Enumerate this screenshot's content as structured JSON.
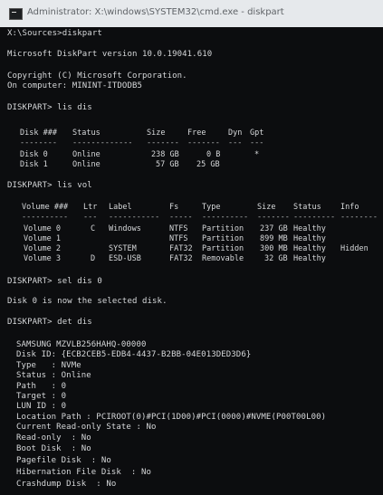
{
  "window": {
    "title": "Administrator: X:\\windows\\SYSTEM32\\cmd.exe - diskpart"
  },
  "console": {
    "prompt_line": "X:\\Sources>diskpart",
    "version_line": "Microsoft DiskPart version 10.0.19041.610",
    "copyright_line": "Copyright (C) Microsoft Corporation.",
    "computer_line": "On computer: MININT-ITDODB5",
    "cmd_lis_dis": "DISKPART> lis dis",
    "cmd_lis_vol": "DISKPART> lis vol",
    "cmd_sel_dis": "DISKPART> sel dis 0",
    "selected_msg": "Disk 0 is now the selected disk.",
    "cmd_det_dis": "DISKPART> det dis"
  },
  "disk_table": {
    "headers": [
      "Disk ###",
      "Status",
      "Size",
      "Free",
      "Dyn",
      "Gpt"
    ],
    "separators": [
      "--------",
      "-------------",
      "-------",
      "-------",
      "---",
      "---"
    ],
    "rows": [
      [
        "Disk 0",
        "Online",
        "238 GB",
        "0 B",
        "",
        "*"
      ],
      [
        "Disk 1",
        "Online",
        "57 GB",
        "25 GB",
        "",
        ""
      ]
    ]
  },
  "volume_table": {
    "headers": [
      "Volume ###",
      "Ltr",
      "Label",
      "Fs",
      "Type",
      "Size",
      "Status",
      "Info"
    ],
    "separators": [
      "----------",
      "---",
      "-----------",
      "-----",
      "----------",
      "-------",
      "---------",
      "--------"
    ],
    "rows": [
      [
        "Volume 0",
        "C",
        "Windows",
        "NTFS",
        "Partition",
        "237 GB",
        "Healthy",
        ""
      ],
      [
        "Volume 1",
        "",
        "",
        "NTFS",
        "Partition",
        "899 MB",
        "Healthy",
        ""
      ],
      [
        "Volume 2",
        "",
        "SYSTEM",
        "FAT32",
        "Partition",
        "300 MB",
        "Healthy",
        "Hidden"
      ],
      [
        "Volume 3",
        "D",
        "ESD-USB",
        "FAT32",
        "Removable",
        "32 GB",
        "Healthy",
        ""
      ]
    ]
  },
  "disk_detail": {
    "model": "SAMSUNG MZVLB256HAHQ-00000",
    "disk_id": "Disk ID: {ECB2CEB5-EDB4-4437-B2BB-04E013DED3D6}",
    "type": "Type   : NVMe",
    "status": "Status : Online",
    "path": "Path   : 0",
    "target": "Target : 0",
    "lun_id": "LUN ID : 0",
    "location_path": "Location Path : PCIROOT(0)#PCI(1D00)#PCI(0000)#NVME(P00T00L00)",
    "current_readonly": "Current Read-only State : No",
    "readonly": "Read-only  : No",
    "boot_disk": "Boot Disk  : No",
    "pagefile_disk": "Pagefile Disk  : No",
    "hibernation_disk": "Hibernation File Disk  : No",
    "crashdump_disk": "Crashdump Disk  : No"
  }
}
